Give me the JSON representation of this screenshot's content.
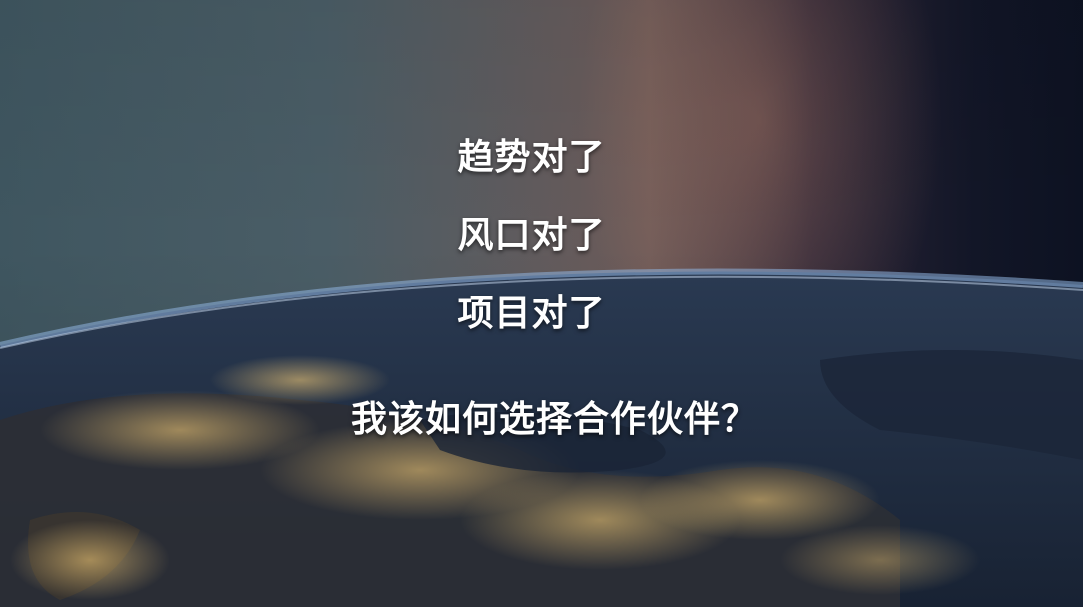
{
  "slide": {
    "lines": [
      "趋势对了",
      "风口对了",
      "项目对了"
    ],
    "question": "我该如何选择合作伙伴？"
  },
  "colors": {
    "text": "#ffffff",
    "atmosphere": "#8fb4e0",
    "city_lights": "#f5c676"
  }
}
